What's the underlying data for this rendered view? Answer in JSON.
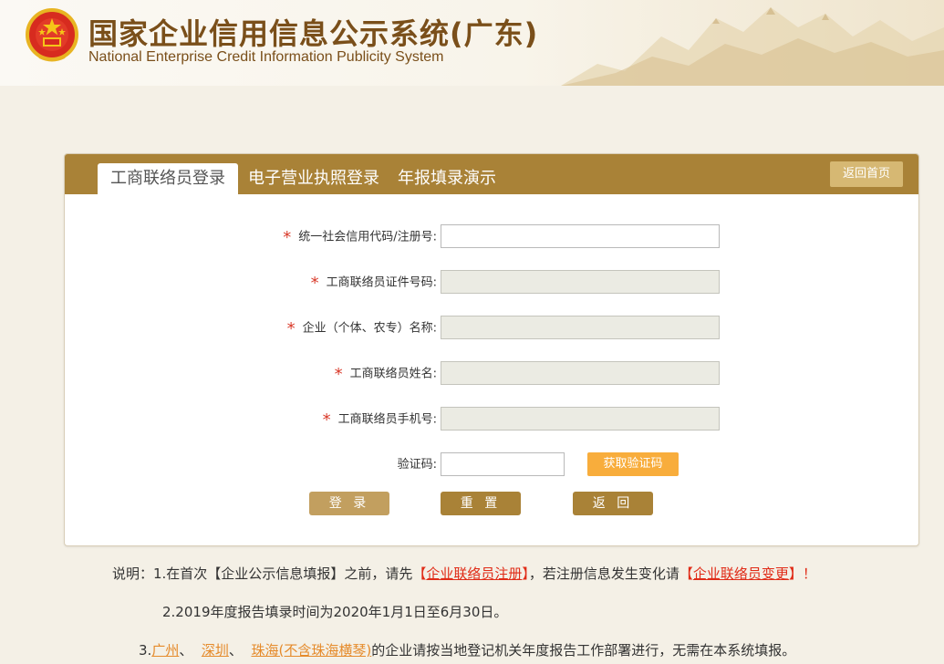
{
  "header": {
    "title": "国家企业信用信息公示系统(广东)",
    "subtitle": "National Enterprise Credit Information Publicity System"
  },
  "tabs": [
    {
      "label": "工商联络员登录",
      "active": true
    },
    {
      "label": "电子营业执照登录",
      "active": false
    },
    {
      "label": "年报填录演示",
      "active": false
    }
  ],
  "home_button": "返回首页",
  "form": {
    "fields": [
      {
        "label": "统一社会信用代码/注册号:",
        "required": true,
        "disabled": false,
        "value": ""
      },
      {
        "label": "工商联络员证件号码:",
        "required": true,
        "disabled": true,
        "value": ""
      },
      {
        "label": "企业（个体、农专）名称:",
        "required": true,
        "disabled": true,
        "value": ""
      },
      {
        "label": "工商联络员姓名:",
        "required": true,
        "disabled": true,
        "value": ""
      },
      {
        "label": "工商联络员手机号:",
        "required": true,
        "disabled": true,
        "value": ""
      }
    ],
    "captcha_label": "验证码:",
    "captcha_value": "",
    "sms_button": "获取验证码",
    "buttons": {
      "login": "登 录",
      "reset": "重 置",
      "back": "返 回"
    }
  },
  "notes": {
    "line1_prefix": "说明：1.在首次【企业公示信息填报】之前，请先",
    "line1_link1": "企业联络员注册",
    "line1_mid": "，若注册信息发生变化请",
    "line1_link2": "企业联络员变更",
    "line1_end": "！",
    "line2": "2.2019年度报告填录时间为2020年1月1日至6月30日。",
    "line3_prefix": "3.",
    "line3_city1": "广州",
    "line3_sep1": "、",
    "line3_city2": "深圳",
    "line3_sep2": "、",
    "line3_city3": "珠海(不含珠海横琴)",
    "line3_suffix": "的企业请按当地登记机关年度报告工作部署进行，无需在本系统填报。"
  },
  "colors": {
    "accent": "#a98237",
    "required_star": "#d93a2a",
    "link_red": "#e02b17",
    "link_orange": "#e58a2a",
    "sms_button": "#f8ad3c"
  }
}
